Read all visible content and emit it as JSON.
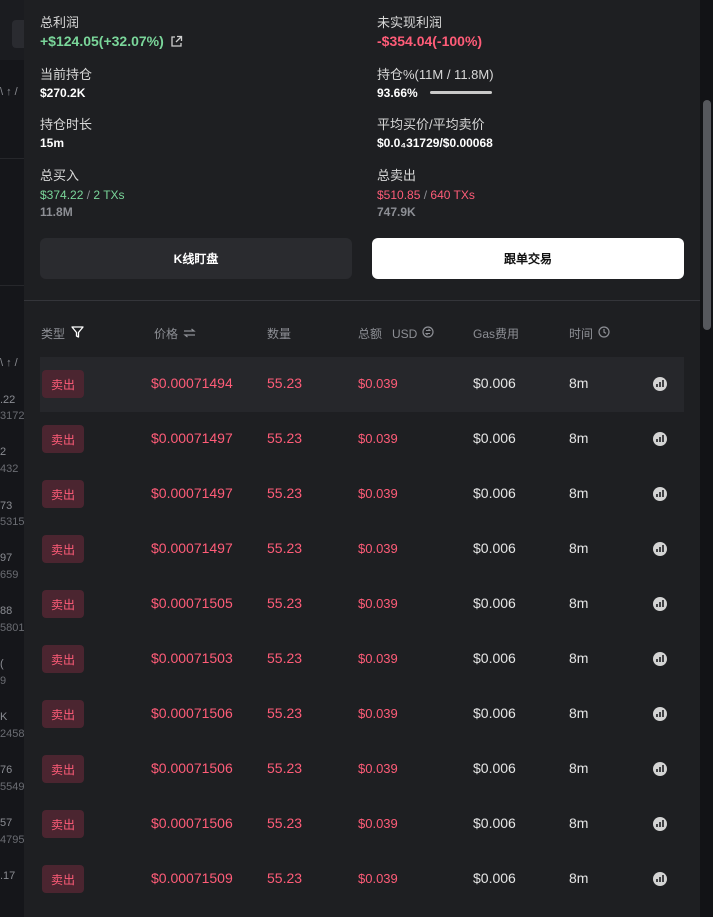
{
  "summary": {
    "total_profit_label": "总利润",
    "total_profit_value": "+$124.05(+32.07%)",
    "unrealized_label": "未实现利润",
    "unrealized_value": "-$354.04(-100%)",
    "current_holding_label": "当前持仓",
    "current_holding_value": "$270.2K",
    "holding_pct_label": "持仓%(11M / 11.8M)",
    "holding_pct_value": "93.66%",
    "holding_duration_label": "持仓时长",
    "holding_duration_value": "15m",
    "avg_price_label": "平均买价/平均卖价",
    "avg_price_value": "$0.0₄31729/$0.00068",
    "total_buy_label": "总买入",
    "total_buy_amount": "$374.22",
    "total_buy_txs": "2 TXs",
    "total_buy_tokens": "11.8M",
    "total_sell_label": "总卖出",
    "total_sell_amount": "$510.85",
    "total_sell_txs": "640 TXs",
    "total_sell_tokens": "747.9K",
    "separator": " / "
  },
  "actions": {
    "kline_label": "K线盯盘",
    "copy_trade_label": "跟单交易"
  },
  "table": {
    "headers": {
      "type": "类型",
      "price": "价格",
      "qty": "数量",
      "total": "总额",
      "total_unit": "USD",
      "gas": "Gas费用",
      "time": "时间"
    },
    "rows": [
      {
        "type": "卖出",
        "price": "$0.00071494",
        "qty": "55.23",
        "total": "$0.039",
        "gas": "$0.006",
        "time": "8m"
      },
      {
        "type": "卖出",
        "price": "$0.00071497",
        "qty": "55.23",
        "total": "$0.039",
        "gas": "$0.006",
        "time": "8m"
      },
      {
        "type": "卖出",
        "price": "$0.00071497",
        "qty": "55.23",
        "total": "$0.039",
        "gas": "$0.006",
        "time": "8m"
      },
      {
        "type": "卖出",
        "price": "$0.00071497",
        "qty": "55.23",
        "total": "$0.039",
        "gas": "$0.006",
        "time": "8m"
      },
      {
        "type": "卖出",
        "price": "$0.00071505",
        "qty": "55.23",
        "total": "$0.039",
        "gas": "$0.006",
        "time": "8m"
      },
      {
        "type": "卖出",
        "price": "$0.00071503",
        "qty": "55.23",
        "total": "$0.039",
        "gas": "$0.006",
        "time": "8m"
      },
      {
        "type": "卖出",
        "price": "$0.00071506",
        "qty": "55.23",
        "total": "$0.039",
        "gas": "$0.006",
        "time": "8m"
      },
      {
        "type": "卖出",
        "price": "$0.00071506",
        "qty": "55.23",
        "total": "$0.039",
        "gas": "$0.006",
        "time": "8m"
      },
      {
        "type": "卖出",
        "price": "$0.00071506",
        "qty": "55.23",
        "total": "$0.039",
        "gas": "$0.006",
        "time": "8m"
      },
      {
        "type": "卖出",
        "price": "$0.00071509",
        "qty": "55.23",
        "total": "$0.039",
        "gas": "$0.006",
        "time": "8m"
      }
    ]
  },
  "background_fragments": [
    "\\ ↑ /",
    ".22",
    "3172",
    "2",
    "432",
    "73",
    "5315",
    "97",
    "659",
    "88",
    "5801",
    "(",
    "9",
    "K",
    "2458",
    "76",
    "5549",
    "57",
    "4795",
    ".17"
  ],
  "colors": {
    "profit_green": "#7ad69a",
    "loss_red": "#ff5c78",
    "panel_bg": "#1e1f22",
    "sell_badge_bg": "#4b2530"
  },
  "icons": {
    "external_link": "external-link-icon",
    "filter": "filter-icon",
    "swap": "swap-icon",
    "currency": "currency-icon",
    "clock": "clock-icon",
    "explorer": "explorer-icon"
  }
}
